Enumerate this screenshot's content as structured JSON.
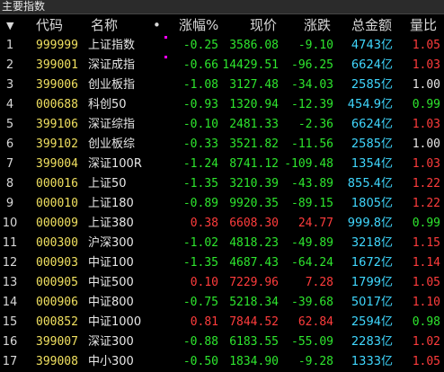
{
  "window": {
    "title": "主要指数"
  },
  "colors": {
    "up": "#ff3c3c",
    "down": "#2ee62e",
    "flat": "#e8e8e8",
    "code": "#f0e060",
    "amount": "#40d8ff",
    "mark": "#ff00ff"
  },
  "header": {
    "sort_icon": "▼",
    "code": "代码",
    "name": "名称",
    "dot": "•",
    "pct": "涨幅%",
    "price": "现价",
    "change": "涨跌",
    "amount": "总金额",
    "ratio": "量比"
  },
  "rows": [
    {
      "idx": "1",
      "code": "999999",
      "name": "上证指数",
      "mark": true,
      "pct": "-0.25",
      "price": "3586.08",
      "change": "-9.10",
      "amount": "4743亿",
      "ratio": "1.05",
      "dir": "down",
      "ratio_dir": "up"
    },
    {
      "idx": "2",
      "code": "399001",
      "name": "深证成指",
      "mark": true,
      "pct": "-0.66",
      "price": "14429.51",
      "change": "-96.25",
      "amount": "6624亿",
      "ratio": "1.03",
      "dir": "down",
      "ratio_dir": "up"
    },
    {
      "idx": "3",
      "code": "399006",
      "name": "创业板指",
      "mark": false,
      "pct": "-1.08",
      "price": "3127.48",
      "change": "-34.03",
      "amount": "2585亿",
      "ratio": "1.00",
      "dir": "down",
      "ratio_dir": "flat"
    },
    {
      "idx": "4",
      "code": "000688",
      "name": "科创50",
      "mark": false,
      "pct": "-0.93",
      "price": "1320.94",
      "change": "-12.39",
      "amount": "454.9亿",
      "ratio": "0.99",
      "dir": "down",
      "ratio_dir": "down"
    },
    {
      "idx": "5",
      "code": "399106",
      "name": "深证综指",
      "mark": false,
      "pct": "-0.10",
      "price": "2481.33",
      "change": "-2.36",
      "amount": "6624亿",
      "ratio": "1.03",
      "dir": "down",
      "ratio_dir": "up"
    },
    {
      "idx": "6",
      "code": "399102",
      "name": "创业板综",
      "mark": false,
      "pct": "-0.33",
      "price": "3521.82",
      "change": "-11.56",
      "amount": "2585亿",
      "ratio": "1.00",
      "dir": "down",
      "ratio_dir": "flat"
    },
    {
      "idx": "7",
      "code": "399004",
      "name": "深证100R",
      "mark": false,
      "pct": "-1.24",
      "price": "8741.12",
      "change": "-109.48",
      "amount": "1354亿",
      "ratio": "1.03",
      "dir": "down",
      "ratio_dir": "up"
    },
    {
      "idx": "8",
      "code": "000016",
      "name": "上证50",
      "mark": false,
      "pct": "-1.35",
      "price": "3210.39",
      "change": "-43.89",
      "amount": "855.4亿",
      "ratio": "1.22",
      "dir": "down",
      "ratio_dir": "up"
    },
    {
      "idx": "9",
      "code": "000010",
      "name": "上证180",
      "mark": false,
      "pct": "-0.89",
      "price": "9920.35",
      "change": "-89.15",
      "amount": "1805亿",
      "ratio": "1.22",
      "dir": "down",
      "ratio_dir": "up"
    },
    {
      "idx": "10",
      "code": "000009",
      "name": "上证380",
      "mark": false,
      "pct": "0.38",
      "price": "6608.30",
      "change": "24.77",
      "amount": "999.8亿",
      "ratio": "0.99",
      "dir": "up",
      "ratio_dir": "down"
    },
    {
      "idx": "11",
      "code": "000300",
      "name": "沪深300",
      "mark": false,
      "pct": "-1.02",
      "price": "4818.23",
      "change": "-49.89",
      "amount": "3218亿",
      "ratio": "1.15",
      "dir": "down",
      "ratio_dir": "up"
    },
    {
      "idx": "12",
      "code": "000903",
      "name": "中证100",
      "mark": false,
      "pct": "-1.35",
      "price": "4687.43",
      "change": "-64.24",
      "amount": "1672亿",
      "ratio": "1.14",
      "dir": "down",
      "ratio_dir": "up"
    },
    {
      "idx": "13",
      "code": "000905",
      "name": "中证500",
      "mark": false,
      "pct": "0.10",
      "price": "7229.96",
      "change": "7.28",
      "amount": "1799亿",
      "ratio": "1.05",
      "dir": "up",
      "ratio_dir": "up"
    },
    {
      "idx": "14",
      "code": "000906",
      "name": "中证800",
      "mark": false,
      "pct": "-0.75",
      "price": "5218.34",
      "change": "-39.68",
      "amount": "5017亿",
      "ratio": "1.10",
      "dir": "down",
      "ratio_dir": "up"
    },
    {
      "idx": "15",
      "code": "000852",
      "name": "中证1000",
      "mark": false,
      "pct": "0.81",
      "price": "7844.52",
      "change": "62.84",
      "amount": "2594亿",
      "ratio": "0.98",
      "dir": "up",
      "ratio_dir": "down"
    },
    {
      "idx": "16",
      "code": "399007",
      "name": "深证300",
      "mark": false,
      "pct": "-0.88",
      "price": "6183.55",
      "change": "-55.09",
      "amount": "2283亿",
      "ratio": "1.02",
      "dir": "down",
      "ratio_dir": "up"
    },
    {
      "idx": "17",
      "code": "399008",
      "name": "中小300",
      "mark": false,
      "pct": "-0.50",
      "price": "1834.90",
      "change": "-9.28",
      "amount": "1333亿",
      "ratio": "1.05",
      "dir": "down",
      "ratio_dir": "up"
    }
  ]
}
